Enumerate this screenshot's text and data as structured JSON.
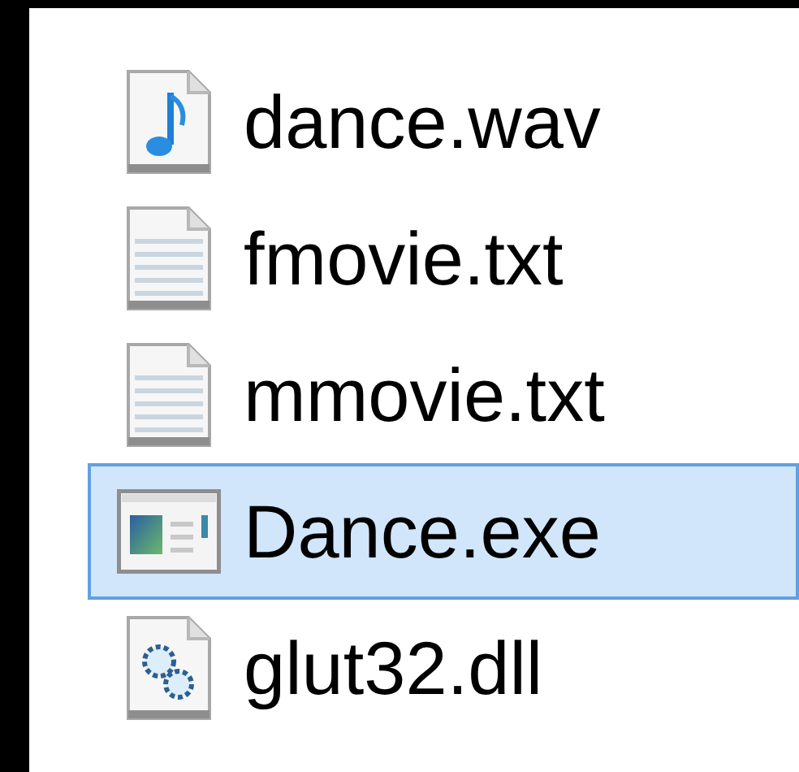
{
  "files": [
    {
      "name": "dance.wav",
      "kind": "audio",
      "selected": false
    },
    {
      "name": "fmovie.txt",
      "kind": "text",
      "selected": false
    },
    {
      "name": "mmovie.txt",
      "kind": "text",
      "selected": false
    },
    {
      "name": "Dance.exe",
      "kind": "program",
      "selected": true
    },
    {
      "name": "glut32.dll",
      "kind": "library",
      "selected": false
    }
  ]
}
